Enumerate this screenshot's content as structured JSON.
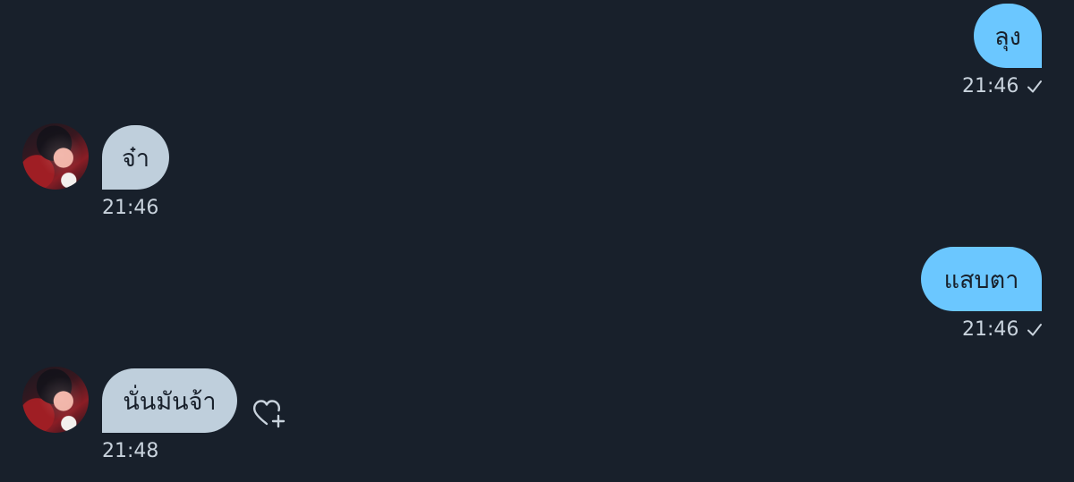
{
  "messages": [
    {
      "side": "sent",
      "text": "ลุง",
      "time": "21:46",
      "status": "delivered-check"
    },
    {
      "side": "received",
      "text": "จ๋า",
      "time": "21:46",
      "avatar": "profile-avatar"
    },
    {
      "side": "sent",
      "text": "แสบตา",
      "time": "21:46",
      "status": "delivered-check"
    },
    {
      "side": "received",
      "text": "นั่นมันจ้า",
      "time": "21:48",
      "avatar": "profile-avatar",
      "reaction_icon": "heart-plus-icon"
    }
  ],
  "colors": {
    "background": "#18202b",
    "sent_bubble": "#6bc7ff",
    "received_bubble": "#bfcfdc",
    "meta_text": "#c9d3dd"
  }
}
